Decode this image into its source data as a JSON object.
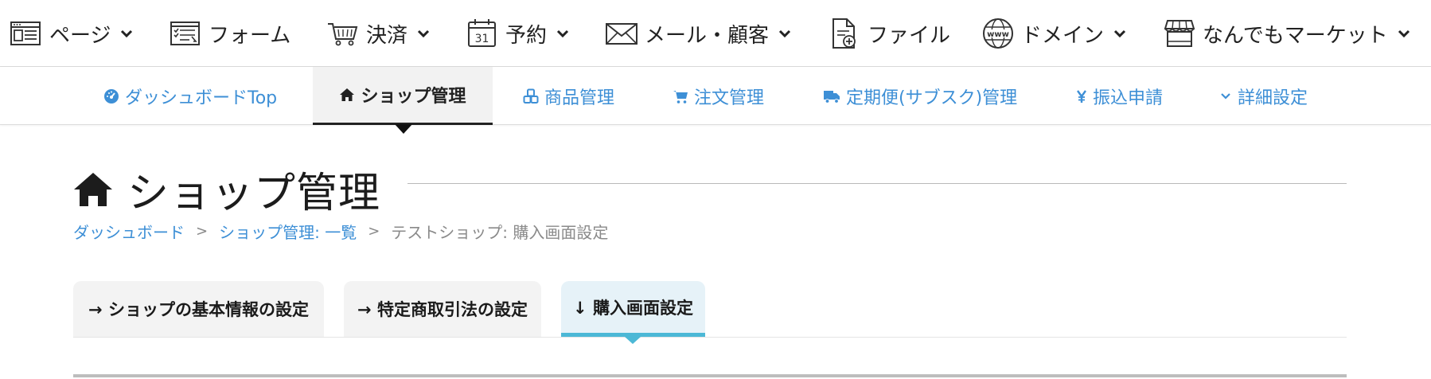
{
  "topnav": {
    "items": [
      {
        "label": "ページ",
        "icon": "page-window-icon",
        "has_dropdown": true
      },
      {
        "label": "フォーム",
        "icon": "form-checklist-icon",
        "has_dropdown": false
      },
      {
        "label": "決済",
        "icon": "shopping-cart-icon",
        "has_dropdown": true
      },
      {
        "label": "予約",
        "icon": "calendar-icon",
        "calendar_day": "31",
        "has_dropdown": true
      },
      {
        "label": "メール・顧客",
        "icon": "envelope-icon",
        "has_dropdown": true
      },
      {
        "label": "ファイル",
        "icon": "file-add-icon",
        "has_dropdown": false
      },
      {
        "label": "ドメイン",
        "icon": "globe-www-icon",
        "globe_text": "www",
        "has_dropdown": true
      },
      {
        "label": "なんでもマーケット",
        "icon": "store-icon",
        "has_dropdown": true
      }
    ]
  },
  "subnav": {
    "items": [
      {
        "label": "ダッシュボードTop",
        "icon": "dashboard-gauge-icon"
      },
      {
        "label": "ショップ管理",
        "icon": "home-icon",
        "active": true
      },
      {
        "label": "商品管理",
        "icon": "cubes-icon"
      },
      {
        "label": "注文管理",
        "icon": "cart-icon"
      },
      {
        "label": "定期便(サブスク)管理",
        "icon": "truck-icon"
      },
      {
        "label": "振込申請",
        "icon": "yen-icon"
      },
      {
        "label": "詳細設定",
        "icon": "chevron-down-icon"
      }
    ]
  },
  "page": {
    "title": "ショップ管理",
    "title_icon": "home-icon"
  },
  "breadcrumb": {
    "items": [
      "ダッシュボード",
      "ショップ管理: 一覧"
    ],
    "separator": ">",
    "current": "テストショップ: 購入画面設定"
  },
  "tabs": [
    {
      "label": "→ ショップの基本情報の設定",
      "active": false
    },
    {
      "label": "→ 特定商取引法の設定",
      "active": false
    },
    {
      "label": "↓ 購入画面設定",
      "active": true
    }
  ],
  "colors": {
    "link": "#3d8fd6",
    "tab_active_bg": "#e6f2f8",
    "tab_active_border": "#4cb8d6",
    "text_dark": "#222222"
  }
}
